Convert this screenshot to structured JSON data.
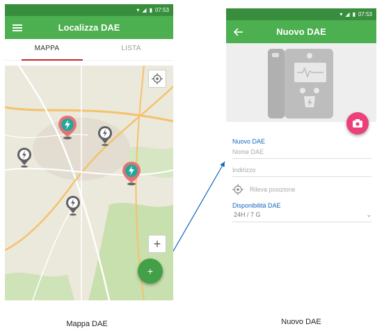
{
  "left_screen": {
    "status": {
      "time": "07:53"
    },
    "appbar": {
      "title": "Localizza DAE",
      "menu_icon": "hamburger-menu-icon"
    },
    "tabs": [
      {
        "label": "MAPPA",
        "active": true
      },
      {
        "label": "LISTA",
        "active": false
      }
    ],
    "map": {
      "locate_icon": "crosshair-icon",
      "zoom_in_label": "+",
      "fab_label": "+"
    }
  },
  "right_screen": {
    "status": {
      "time": "07:53"
    },
    "appbar": {
      "title": "Nuovo DAE",
      "back_icon": "arrow-left-icon"
    },
    "camera_icon": "camera-icon",
    "form": {
      "section_title": "Nuovo DAE",
      "name_placeholder": "Nome DAE",
      "address_placeholder": "Indirizzo",
      "locate_label": "Rileva posizione",
      "availability_title": "Disponibilità DAE",
      "availability_value": "24H / 7 G"
    }
  },
  "captions": {
    "left": "Mappa DAE",
    "right": "Nuovo DAE"
  },
  "colors": {
    "green": "#4caf50",
    "dark_green": "#388e3c",
    "pink": "#ec407a",
    "blue": "#1565c0",
    "red": "#c62828"
  }
}
